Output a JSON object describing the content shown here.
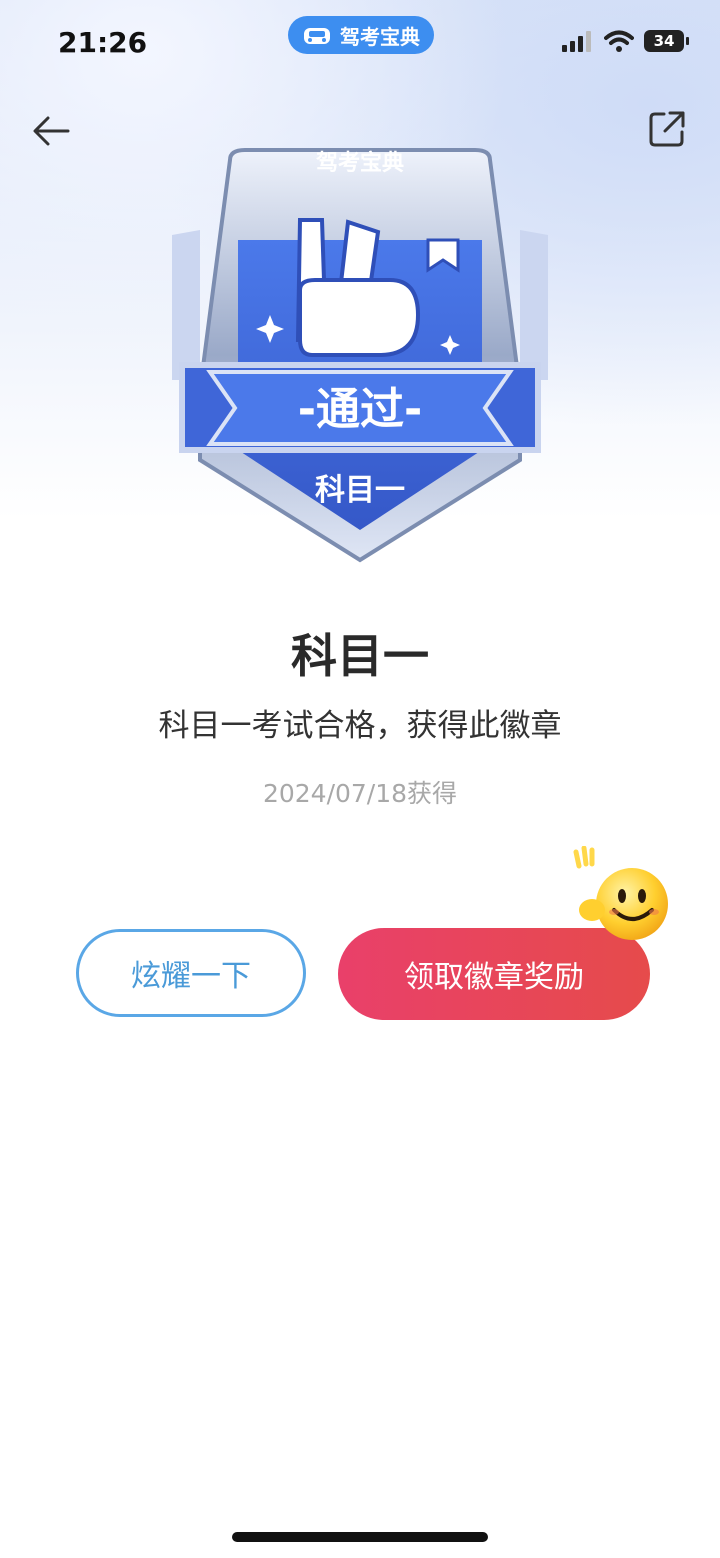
{
  "status_bar": {
    "time": "21:26",
    "battery": "34",
    "icons": [
      "signal-icon",
      "wifi-icon",
      "battery-icon"
    ]
  },
  "app_pill": {
    "label": "驾考宝典",
    "icon": "car-icon",
    "color": "#3d8ef0"
  },
  "header": {
    "back_icon": "back-arrow-icon",
    "share_icon": "share-icon"
  },
  "badge": {
    "brand": "驾考宝典",
    "ribbon_text": "-通过-",
    "subject": "科目一",
    "color": "#3f6be0"
  },
  "main": {
    "title": "科目一",
    "description": "科目一考试合格，获得此徽章",
    "date": "2024/07/18获得"
  },
  "actions": {
    "show_off": "炫耀一下",
    "claim_reward": "领取徽章奖励",
    "claim_color": "#e9406a",
    "show_color": "#5aa7e6"
  }
}
